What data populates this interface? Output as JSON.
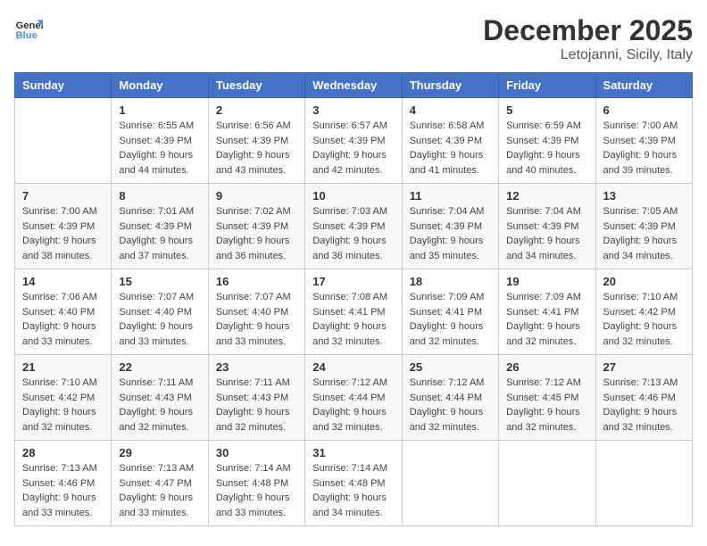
{
  "header": {
    "logo_line1": "General",
    "logo_line2": "Blue",
    "month": "December 2025",
    "location": "Letojanni, Sicily, Italy"
  },
  "days_of_week": [
    "Sunday",
    "Monday",
    "Tuesday",
    "Wednesday",
    "Thursday",
    "Friday",
    "Saturday"
  ],
  "weeks": [
    [
      {
        "day": "",
        "sunrise": "",
        "sunset": "",
        "daylight": ""
      },
      {
        "day": "1",
        "sunrise": "Sunrise: 6:55 AM",
        "sunset": "Sunset: 4:39 PM",
        "daylight": "Daylight: 9 hours and 44 minutes."
      },
      {
        "day": "2",
        "sunrise": "Sunrise: 6:56 AM",
        "sunset": "Sunset: 4:39 PM",
        "daylight": "Daylight: 9 hours and 43 minutes."
      },
      {
        "day": "3",
        "sunrise": "Sunrise: 6:57 AM",
        "sunset": "Sunset: 4:39 PM",
        "daylight": "Daylight: 9 hours and 42 minutes."
      },
      {
        "day": "4",
        "sunrise": "Sunrise: 6:58 AM",
        "sunset": "Sunset: 4:39 PM",
        "daylight": "Daylight: 9 hours and 41 minutes."
      },
      {
        "day": "5",
        "sunrise": "Sunrise: 6:59 AM",
        "sunset": "Sunset: 4:39 PM",
        "daylight": "Daylight: 9 hours and 40 minutes."
      },
      {
        "day": "6",
        "sunrise": "Sunrise: 7:00 AM",
        "sunset": "Sunset: 4:39 PM",
        "daylight": "Daylight: 9 hours and 39 minutes."
      }
    ],
    [
      {
        "day": "7",
        "sunrise": "Sunrise: 7:00 AM",
        "sunset": "Sunset: 4:39 PM",
        "daylight": "Daylight: 9 hours and 38 minutes."
      },
      {
        "day": "8",
        "sunrise": "Sunrise: 7:01 AM",
        "sunset": "Sunset: 4:39 PM",
        "daylight": "Daylight: 9 hours and 37 minutes."
      },
      {
        "day": "9",
        "sunrise": "Sunrise: 7:02 AM",
        "sunset": "Sunset: 4:39 PM",
        "daylight": "Daylight: 9 hours and 36 minutes."
      },
      {
        "day": "10",
        "sunrise": "Sunrise: 7:03 AM",
        "sunset": "Sunset: 4:39 PM",
        "daylight": "Daylight: 9 hours and 36 minutes."
      },
      {
        "day": "11",
        "sunrise": "Sunrise: 7:04 AM",
        "sunset": "Sunset: 4:39 PM",
        "daylight": "Daylight: 9 hours and 35 minutes."
      },
      {
        "day": "12",
        "sunrise": "Sunrise: 7:04 AM",
        "sunset": "Sunset: 4:39 PM",
        "daylight": "Daylight: 9 hours and 34 minutes."
      },
      {
        "day": "13",
        "sunrise": "Sunrise: 7:05 AM",
        "sunset": "Sunset: 4:39 PM",
        "daylight": "Daylight: 9 hours and 34 minutes."
      }
    ],
    [
      {
        "day": "14",
        "sunrise": "Sunrise: 7:06 AM",
        "sunset": "Sunset: 4:40 PM",
        "daylight": "Daylight: 9 hours and 33 minutes."
      },
      {
        "day": "15",
        "sunrise": "Sunrise: 7:07 AM",
        "sunset": "Sunset: 4:40 PM",
        "daylight": "Daylight: 9 hours and 33 minutes."
      },
      {
        "day": "16",
        "sunrise": "Sunrise: 7:07 AM",
        "sunset": "Sunset: 4:40 PM",
        "daylight": "Daylight: 9 hours and 33 minutes."
      },
      {
        "day": "17",
        "sunrise": "Sunrise: 7:08 AM",
        "sunset": "Sunset: 4:41 PM",
        "daylight": "Daylight: 9 hours and 32 minutes."
      },
      {
        "day": "18",
        "sunrise": "Sunrise: 7:09 AM",
        "sunset": "Sunset: 4:41 PM",
        "daylight": "Daylight: 9 hours and 32 minutes."
      },
      {
        "day": "19",
        "sunrise": "Sunrise: 7:09 AM",
        "sunset": "Sunset: 4:41 PM",
        "daylight": "Daylight: 9 hours and 32 minutes."
      },
      {
        "day": "20",
        "sunrise": "Sunrise: 7:10 AM",
        "sunset": "Sunset: 4:42 PM",
        "daylight": "Daylight: 9 hours and 32 minutes."
      }
    ],
    [
      {
        "day": "21",
        "sunrise": "Sunrise: 7:10 AM",
        "sunset": "Sunset: 4:42 PM",
        "daylight": "Daylight: 9 hours and 32 minutes."
      },
      {
        "day": "22",
        "sunrise": "Sunrise: 7:11 AM",
        "sunset": "Sunset: 4:43 PM",
        "daylight": "Daylight: 9 hours and 32 minutes."
      },
      {
        "day": "23",
        "sunrise": "Sunrise: 7:11 AM",
        "sunset": "Sunset: 4:43 PM",
        "daylight": "Daylight: 9 hours and 32 minutes."
      },
      {
        "day": "24",
        "sunrise": "Sunrise: 7:12 AM",
        "sunset": "Sunset: 4:44 PM",
        "daylight": "Daylight: 9 hours and 32 minutes."
      },
      {
        "day": "25",
        "sunrise": "Sunrise: 7:12 AM",
        "sunset": "Sunset: 4:44 PM",
        "daylight": "Daylight: 9 hours and 32 minutes."
      },
      {
        "day": "26",
        "sunrise": "Sunrise: 7:12 AM",
        "sunset": "Sunset: 4:45 PM",
        "daylight": "Daylight: 9 hours and 32 minutes."
      },
      {
        "day": "27",
        "sunrise": "Sunrise: 7:13 AM",
        "sunset": "Sunset: 4:46 PM",
        "daylight": "Daylight: 9 hours and 32 minutes."
      }
    ],
    [
      {
        "day": "28",
        "sunrise": "Sunrise: 7:13 AM",
        "sunset": "Sunset: 4:46 PM",
        "daylight": "Daylight: 9 hours and 33 minutes."
      },
      {
        "day": "29",
        "sunrise": "Sunrise: 7:13 AM",
        "sunset": "Sunset: 4:47 PM",
        "daylight": "Daylight: 9 hours and 33 minutes."
      },
      {
        "day": "30",
        "sunrise": "Sunrise: 7:14 AM",
        "sunset": "Sunset: 4:48 PM",
        "daylight": "Daylight: 9 hours and 33 minutes."
      },
      {
        "day": "31",
        "sunrise": "Sunrise: 7:14 AM",
        "sunset": "Sunset: 4:48 PM",
        "daylight": "Daylight: 9 hours and 34 minutes."
      },
      {
        "day": "",
        "sunrise": "",
        "sunset": "",
        "daylight": ""
      },
      {
        "day": "",
        "sunrise": "",
        "sunset": "",
        "daylight": ""
      },
      {
        "day": "",
        "sunrise": "",
        "sunset": "",
        "daylight": ""
      }
    ]
  ]
}
